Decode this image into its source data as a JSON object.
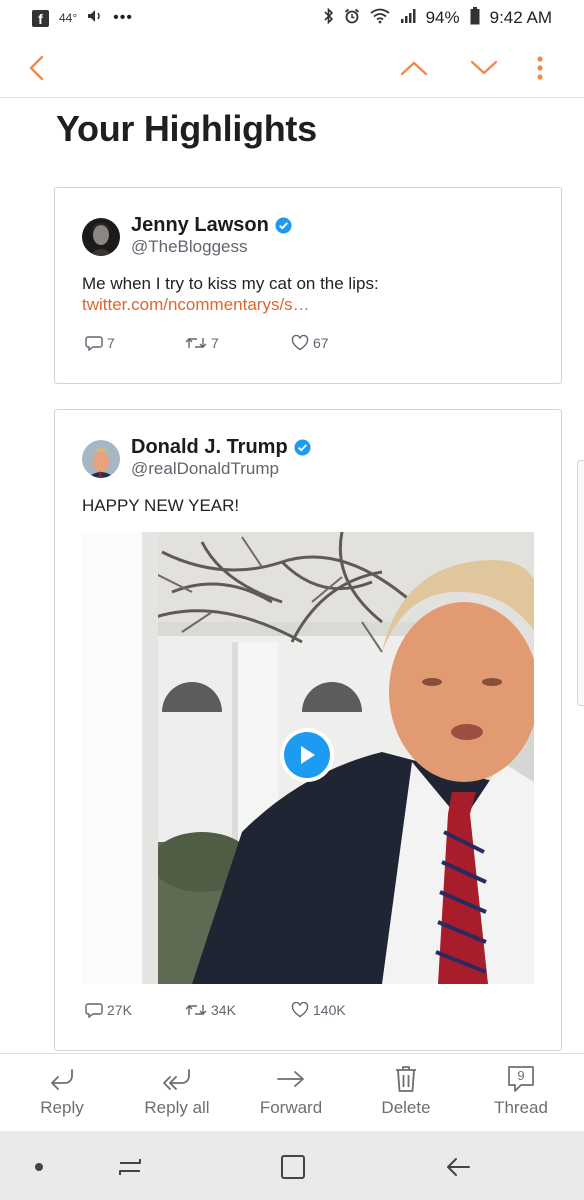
{
  "status_bar": {
    "temperature": "44°",
    "battery": "94%",
    "time": "9:42 AM",
    "icons": [
      "facebook-icon",
      "volume-icon",
      "more-dots-icon",
      "bluetooth-icon",
      "alarm-icon",
      "wifi-icon",
      "signal-icon",
      "battery-icon"
    ]
  },
  "toolbar": {
    "icons": [
      "chevron-left-icon",
      "chevron-up-icon",
      "chevron-down-icon",
      "more-vertical-icon"
    ],
    "accent": "#f08a4b"
  },
  "page": {
    "title": "Your Highlights"
  },
  "tweets": [
    {
      "name": "Jenny Lawson",
      "handle": "@TheBloggess",
      "text": "Me when I try to kiss my cat on the lips:",
      "link": "twitter.com/ncommentarys/s…",
      "replies": "7",
      "retweets": "7",
      "likes": "67"
    },
    {
      "name": "Donald J. Trump",
      "handle": "@realDonaldTrump",
      "text": "HAPPY NEW YEAR!",
      "replies": "27K",
      "retweets": "34K",
      "likes": "140K",
      "media": "video-thumbnail"
    }
  ],
  "actions": [
    {
      "label": "Reply",
      "icon": "reply-icon"
    },
    {
      "label": "Reply all",
      "icon": "reply-all-icon"
    },
    {
      "label": "Forward",
      "icon": "forward-icon"
    },
    {
      "label": "Delete",
      "icon": "trash-icon"
    },
    {
      "label": "Thread",
      "icon": "thread-icon",
      "count": "9"
    }
  ],
  "nav_bar": {
    "icons": [
      "dot-icon",
      "recents-icon",
      "home-icon",
      "back-icon"
    ]
  },
  "colors": {
    "link": "#e0652c",
    "verified": "#1d9bf0",
    "muted_text": "#60666d"
  }
}
